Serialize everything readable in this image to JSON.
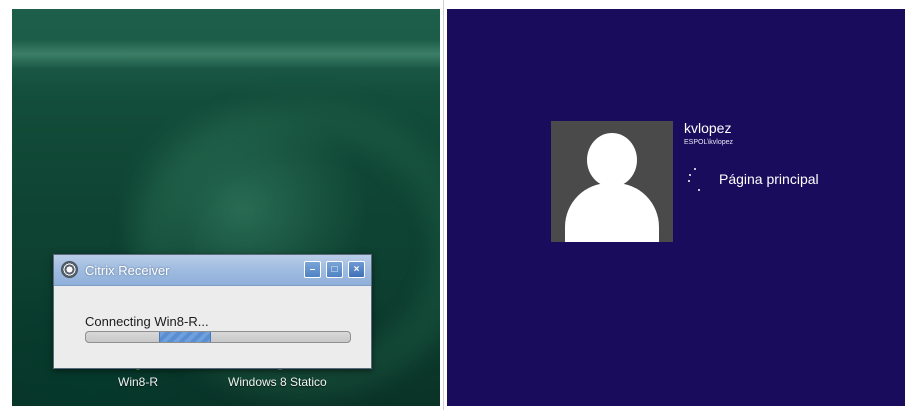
{
  "left_screen": {
    "dialog": {
      "title": "Citrix Receiver",
      "message": "Connecting Win8-R...",
      "progress_state": "indeterminate",
      "buttons": {
        "minimize": "–",
        "maximize": "□",
        "close": "×"
      }
    },
    "desktop_icons": [
      {
        "label": "Win8-R"
      },
      {
        "label": "Windows 8 Statico"
      }
    ]
  },
  "right_screen": {
    "background_color": "#190c5c",
    "user": {
      "name": "kvlopez",
      "account": "ESPOL\\kvlopez"
    },
    "status": "Página principal"
  }
}
